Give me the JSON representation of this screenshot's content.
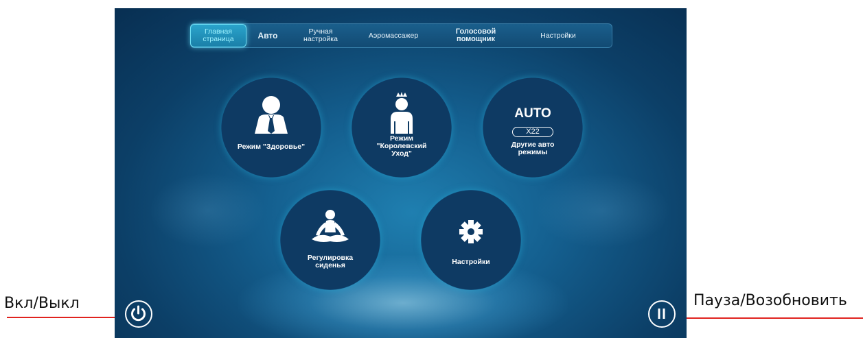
{
  "annotations": {
    "left_label": "Вкл/Выкл",
    "right_label": "Пауза/Возобновить"
  },
  "tabs": [
    {
      "label": "Главная\nстраница",
      "active": true
    },
    {
      "label": "Авто",
      "active": false
    },
    {
      "label": "Ручная\nнастройка",
      "active": false
    },
    {
      "label": "Аэромассажер",
      "active": false
    },
    {
      "label": "Голосовой\nпомощник",
      "active": false
    },
    {
      "label": "Настройки",
      "active": false
    }
  ],
  "modes": {
    "health": {
      "label": "Режим \"Здоровье\"",
      "icon": "businessman-icon"
    },
    "royal": {
      "label": "Режим\n\"Королевский\nУход\"",
      "icon": "crowned-person-icon"
    },
    "auto": {
      "title": "AUTO",
      "badge": "X22",
      "label": "Другие авто\nрежимы"
    },
    "seat": {
      "label": "Регулировка\nсиденья",
      "icon": "meditation-icon"
    },
    "settings": {
      "label": "Настройки",
      "icon": "gear-icon"
    }
  },
  "controls": {
    "power": {
      "icon": "power-icon"
    },
    "pause": {
      "icon": "pause-icon"
    }
  },
  "colors": {
    "accent": "#3fd8e0",
    "annotation_line": "#e0231f"
  }
}
